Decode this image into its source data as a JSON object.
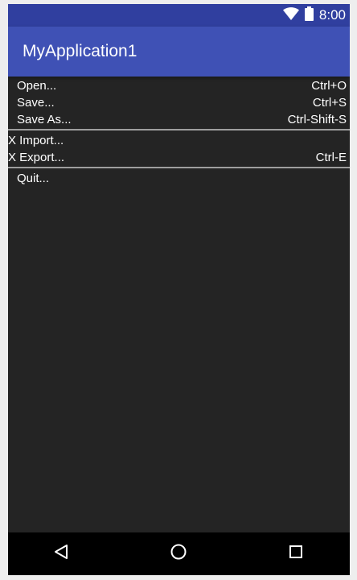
{
  "status_bar": {
    "time": "8:00",
    "icons": [
      "wifi-icon",
      "battery-icon"
    ],
    "color": "#303f9f"
  },
  "app_bar": {
    "title": "MyApplication1",
    "color": "#3f51b5"
  },
  "menu": {
    "groups": [
      [
        {
          "label": "Open...",
          "shortcut": "Ctrl+O"
        },
        {
          "label": "Save...",
          "shortcut": "Ctrl+S"
        },
        {
          "label": "Save As...",
          "shortcut": "Ctrl-Shift-S"
        }
      ],
      [
        {
          "label": "X Import...",
          "shortcut": ""
        },
        {
          "label": "X Export...",
          "shortcut": "Ctrl-E"
        }
      ],
      [
        {
          "label": "Quit...",
          "shortcut": ""
        }
      ]
    ]
  },
  "nav_bar": {
    "icons": [
      "back-icon",
      "home-icon",
      "recents-icon"
    ]
  }
}
